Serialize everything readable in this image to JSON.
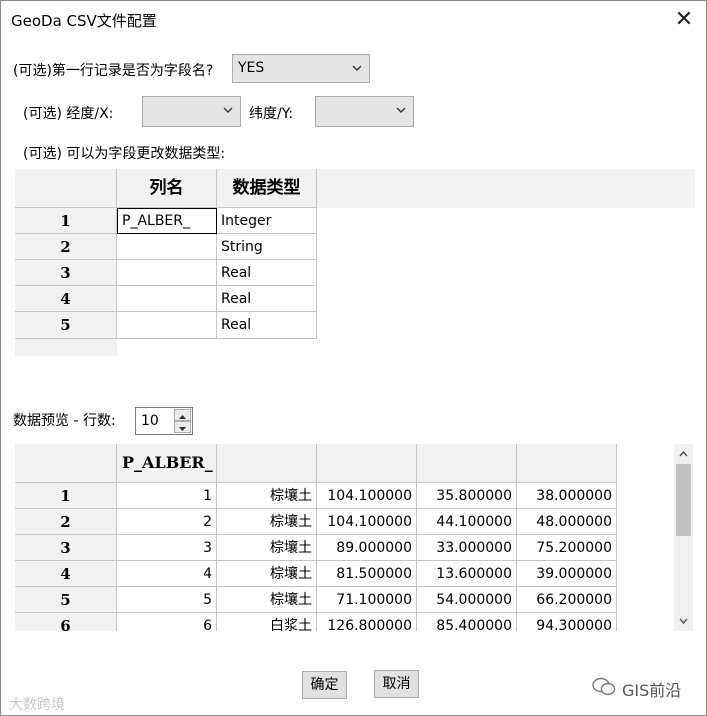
{
  "window": {
    "title": "GeoDa CSV文件配置",
    "close_glyph": "✕"
  },
  "options": {
    "header_row_label": "(可选)第一行记录是否为字段名?",
    "header_row_value": "YES",
    "lon_label": "(可选)  经度/X:",
    "lon_value": "",
    "lat_label": "纬度/Y:",
    "lat_value": "",
    "type_change_label": "(可选)  可以为字段更改数据类型:"
  },
  "field_grid": {
    "headers": [
      "列名",
      "数据类型"
    ],
    "rows": [
      {
        "num": "1",
        "name": "P_ALBER_",
        "type": "Integer"
      },
      {
        "num": "2",
        "name": "",
        "type": "String"
      },
      {
        "num": "3",
        "name": "",
        "type": "Real"
      },
      {
        "num": "4",
        "name": "",
        "type": "Real"
      },
      {
        "num": "5",
        "name": "",
        "type": "Real"
      }
    ]
  },
  "preview": {
    "label": "数据预览 - 行数:",
    "rows_value": "10",
    "headers": [
      "P_ALBER_",
      "",
      "",
      "",
      ""
    ],
    "rows": [
      {
        "num": "1",
        "c1": "1",
        "c2": "棕壤土",
        "c3": "104.100000",
        "c4": "35.800000",
        "c5": "38.000000"
      },
      {
        "num": "2",
        "c1": "2",
        "c2": "棕壤土",
        "c3": "104.100000",
        "c4": "44.100000",
        "c5": "48.000000"
      },
      {
        "num": "3",
        "c1": "3",
        "c2": "棕壤土",
        "c3": "89.000000",
        "c4": "33.000000",
        "c5": "75.200000"
      },
      {
        "num": "4",
        "c1": "4",
        "c2": "棕壤土",
        "c3": "81.500000",
        "c4": "13.600000",
        "c5": "39.000000"
      },
      {
        "num": "5",
        "c1": "5",
        "c2": "棕壤土",
        "c3": "71.100000",
        "c4": "54.000000",
        "c5": "66.200000"
      },
      {
        "num": "6",
        "c1": "6",
        "c2": "白浆土",
        "c3": "126.800000",
        "c4": "85.400000",
        "c5": "94.300000"
      }
    ]
  },
  "buttons": {
    "ok": "确定",
    "cancel": "取消"
  },
  "watermarks": {
    "left": "大数跨境",
    "right": "GIS前沿"
  }
}
